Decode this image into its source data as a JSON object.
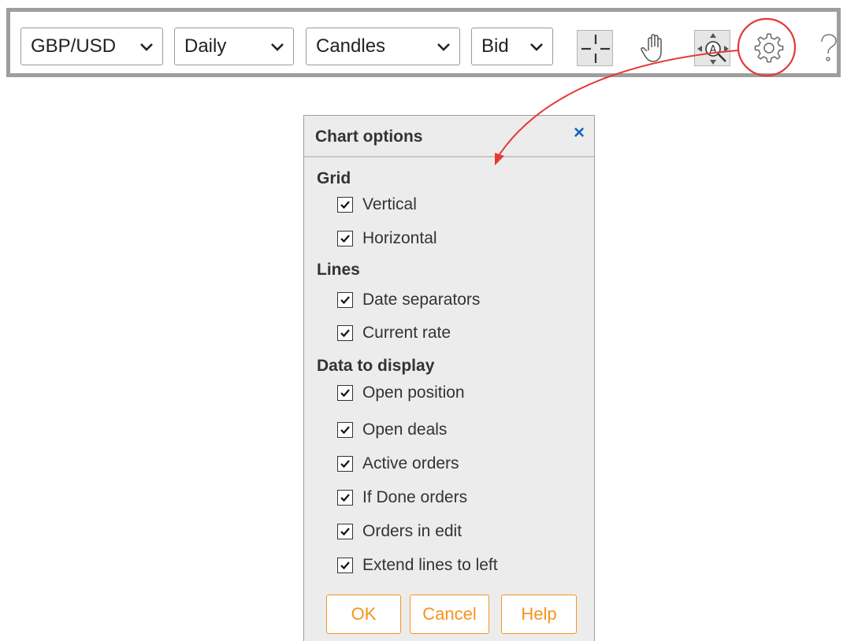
{
  "toolbar": {
    "symbol": {
      "value": "GBP/USD"
    },
    "period": {
      "value": "Daily"
    },
    "chart_type": {
      "value": "Candles"
    },
    "price_side": {
      "value": "Bid"
    },
    "tools": [
      "crosshair-icon",
      "hand-pan-icon",
      "auto-scale-icon",
      "gear-icon",
      "help-icon"
    ],
    "highlight_color": "#e53935"
  },
  "dialog": {
    "title": "Chart options",
    "close": "×",
    "sections": [
      {
        "title": "Grid",
        "options": [
          {
            "label": "Vertical",
            "checked": true
          },
          {
            "label": "Horizontal",
            "checked": true
          }
        ]
      },
      {
        "title": "Lines",
        "options": [
          {
            "label": "Date separators",
            "checked": true
          },
          {
            "label": "Current rate",
            "checked": true
          }
        ]
      },
      {
        "title": "Data to display",
        "options": [
          {
            "label": "Open position",
            "checked": true
          },
          {
            "label": "Open deals",
            "checked": true
          },
          {
            "label": "Active orders",
            "checked": true
          },
          {
            "label": "If Done orders",
            "checked": true
          },
          {
            "label": "Orders in edit",
            "checked": true
          },
          {
            "label": "Extend lines to left",
            "checked": true
          }
        ]
      }
    ],
    "buttons": {
      "ok": "OK",
      "cancel": "Cancel",
      "help": "Help"
    },
    "accent_color": "#f7941d",
    "close_color": "#1565c0"
  }
}
